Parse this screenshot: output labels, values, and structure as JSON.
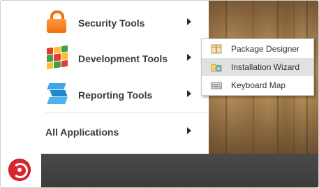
{
  "start_menu": {
    "items": [
      {
        "label": "Security Tools",
        "icon": "lock-icon"
      },
      {
        "label": "Development Tools",
        "icon": "rubik-cube-icon"
      },
      {
        "label": "Reporting Tools",
        "icon": "reporting-icon"
      },
      {
        "label": "All Applications",
        "icon": ""
      }
    ]
  },
  "submenu": {
    "items": [
      {
        "label": "Package Designer",
        "icon": "package-icon",
        "selected": false
      },
      {
        "label": "Installation Wizard",
        "icon": "folder-disc-icon",
        "selected": true
      },
      {
        "label": "Keyboard Map",
        "icon": "keyboard-icon",
        "selected": false
      }
    ]
  },
  "taskbar": {
    "start_icon": "sencha-logo-icon"
  },
  "colors": {
    "accent": "#d8262c",
    "menu_text": "#3a3a3a",
    "taskbar": "#404040",
    "selected_bg": "#e1e1e1"
  }
}
